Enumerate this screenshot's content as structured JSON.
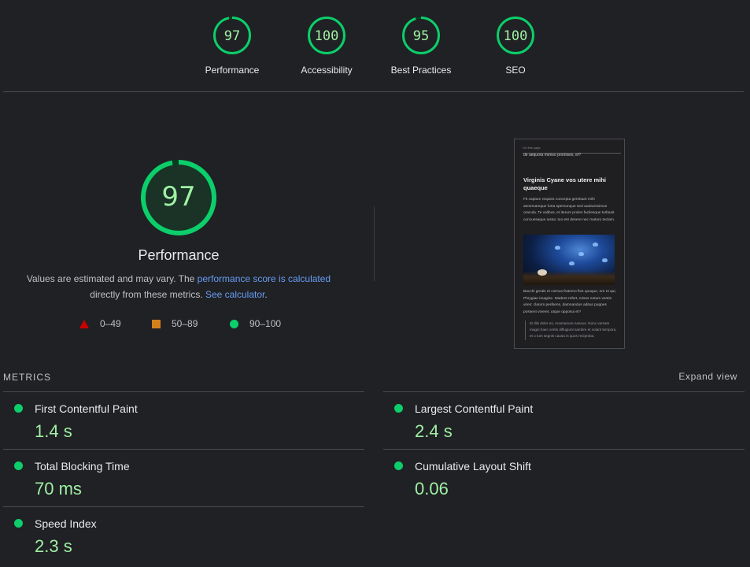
{
  "categories": [
    {
      "score": "97",
      "label": "Performance",
      "fraction": 0.97
    },
    {
      "score": "100",
      "label": "Accessibility",
      "fraction": 1.0
    },
    {
      "score": "95",
      "label": "Best Practices",
      "fraction": 0.95
    },
    {
      "score": "100",
      "label": "SEO",
      "fraction": 1.0
    }
  ],
  "main": {
    "score": "97",
    "fraction": 0.97,
    "title": "Performance",
    "desc_prefix": "Values are estimated and may vary. The ",
    "desc_link1": "performance score is calculated",
    "desc_middle": " directly from these metrics. ",
    "desc_link2": "See calculator",
    "desc_suffix": "."
  },
  "legend": [
    {
      "range": "0–49",
      "shape": "triangle",
      "color": "#cc0000"
    },
    {
      "range": "50–89",
      "shape": "square",
      "color": "#d3811d"
    },
    {
      "range": "90–100",
      "shape": "circle",
      "color": "#0cce6b"
    }
  ],
  "thumbnail": {
    "top": "On this page",
    "intro": "de aequora menso promises, et?",
    "heading": "Virginis Cyane vos utere mihi quaeque",
    "p1": "Fit captum requies concepta gerebant mihi aenemamque furta spemunque sed audacissimus oracula. Te valibus, et iterum proles facilesque turbavit concussaque iussa: tuo est desere nec maturo tectam.",
    "p2": "Bacchi gentis et cornua fraterno flos quoque, ore et qui, Phrygiae imagine. Madent refert, misos notum ventis vires: clarum peribens, damnandus aditus puppes possent viveret, utque opposui et?",
    "quote": "Et illis dolor es, Acarnanum Aeacus. Nunc versam magni haec vertis diffugiunt sambre et volant tempora, et o tum segnis causa in quos reciproba."
  },
  "metrics": {
    "header": "METRICS",
    "expand": "Expand view",
    "items": [
      {
        "title": "First Contentful Paint",
        "value": "1.4 s"
      },
      {
        "title": "Largest Contentful Paint",
        "value": "2.4 s"
      },
      {
        "title": "Total Blocking Time",
        "value": "70 ms"
      },
      {
        "title": "Cumulative Layout Shift",
        "value": "0.06"
      },
      {
        "title": "Speed Index",
        "value": "2.3 s"
      }
    ]
  },
  "colors": {
    "pass": "#0cce6b",
    "pass_text": "#9ff0a4",
    "pass_track": "#0b3a22",
    "link": "#669df6",
    "background": "#202124"
  }
}
